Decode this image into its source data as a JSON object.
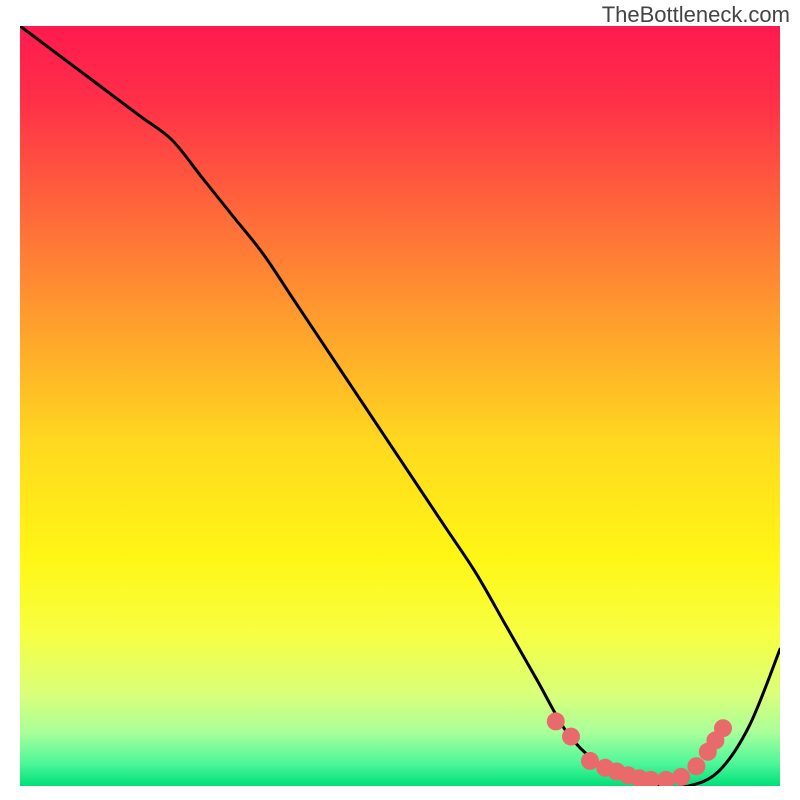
{
  "watermark": "TheBottleneck.com",
  "chart_data": {
    "type": "line",
    "title": "",
    "xlabel": "",
    "ylabel": "",
    "xlim": [
      0,
      100
    ],
    "ylim": [
      0,
      100
    ],
    "background_gradient": {
      "direction": "vertical",
      "stops": [
        {
          "pos": 0.0,
          "color": "#ff1a4e"
        },
        {
          "pos": 0.1,
          "color": "#ff3048"
        },
        {
          "pos": 0.25,
          "color": "#ff6a3a"
        },
        {
          "pos": 0.4,
          "color": "#ffa22c"
        },
        {
          "pos": 0.55,
          "color": "#ffd91f"
        },
        {
          "pos": 0.7,
          "color": "#fff615"
        },
        {
          "pos": 0.8,
          "color": "#f7ff42"
        },
        {
          "pos": 0.88,
          "color": "#d9ff7a"
        },
        {
          "pos": 0.93,
          "color": "#a8ff9a"
        },
        {
          "pos": 0.97,
          "color": "#4ef79a"
        },
        {
          "pos": 1.0,
          "color": "#00e07a"
        }
      ]
    },
    "series": [
      {
        "name": "bottleneck-curve",
        "color": "#000000",
        "x": [
          0,
          4,
          8,
          12,
          16,
          20,
          24,
          28,
          32,
          36,
          40,
          44,
          48,
          52,
          56,
          60,
          64,
          68,
          72,
          76,
          80,
          84,
          88,
          92,
          96,
          100
        ],
        "y": [
          100,
          97,
          94,
          91,
          88,
          85,
          80,
          75,
          70,
          64,
          58,
          52,
          46,
          40,
          34,
          28,
          21,
          14,
          7,
          3,
          1,
          0,
          0,
          2,
          8,
          18
        ]
      }
    ],
    "markers": {
      "name": "valley-dots",
      "color": "#e86a6a",
      "shape": "circle",
      "radius": 9,
      "x": [
        70.5,
        72.5,
        75,
        77,
        78.5,
        80,
        81.5,
        83,
        85,
        87,
        89,
        90.5,
        91.5,
        92.5
      ],
      "y": [
        8.5,
        6.5,
        3.3,
        2.4,
        1.9,
        1.4,
        1.0,
        0.8,
        0.8,
        1.2,
        2.6,
        4.5,
        6.0,
        7.6
      ]
    }
  }
}
